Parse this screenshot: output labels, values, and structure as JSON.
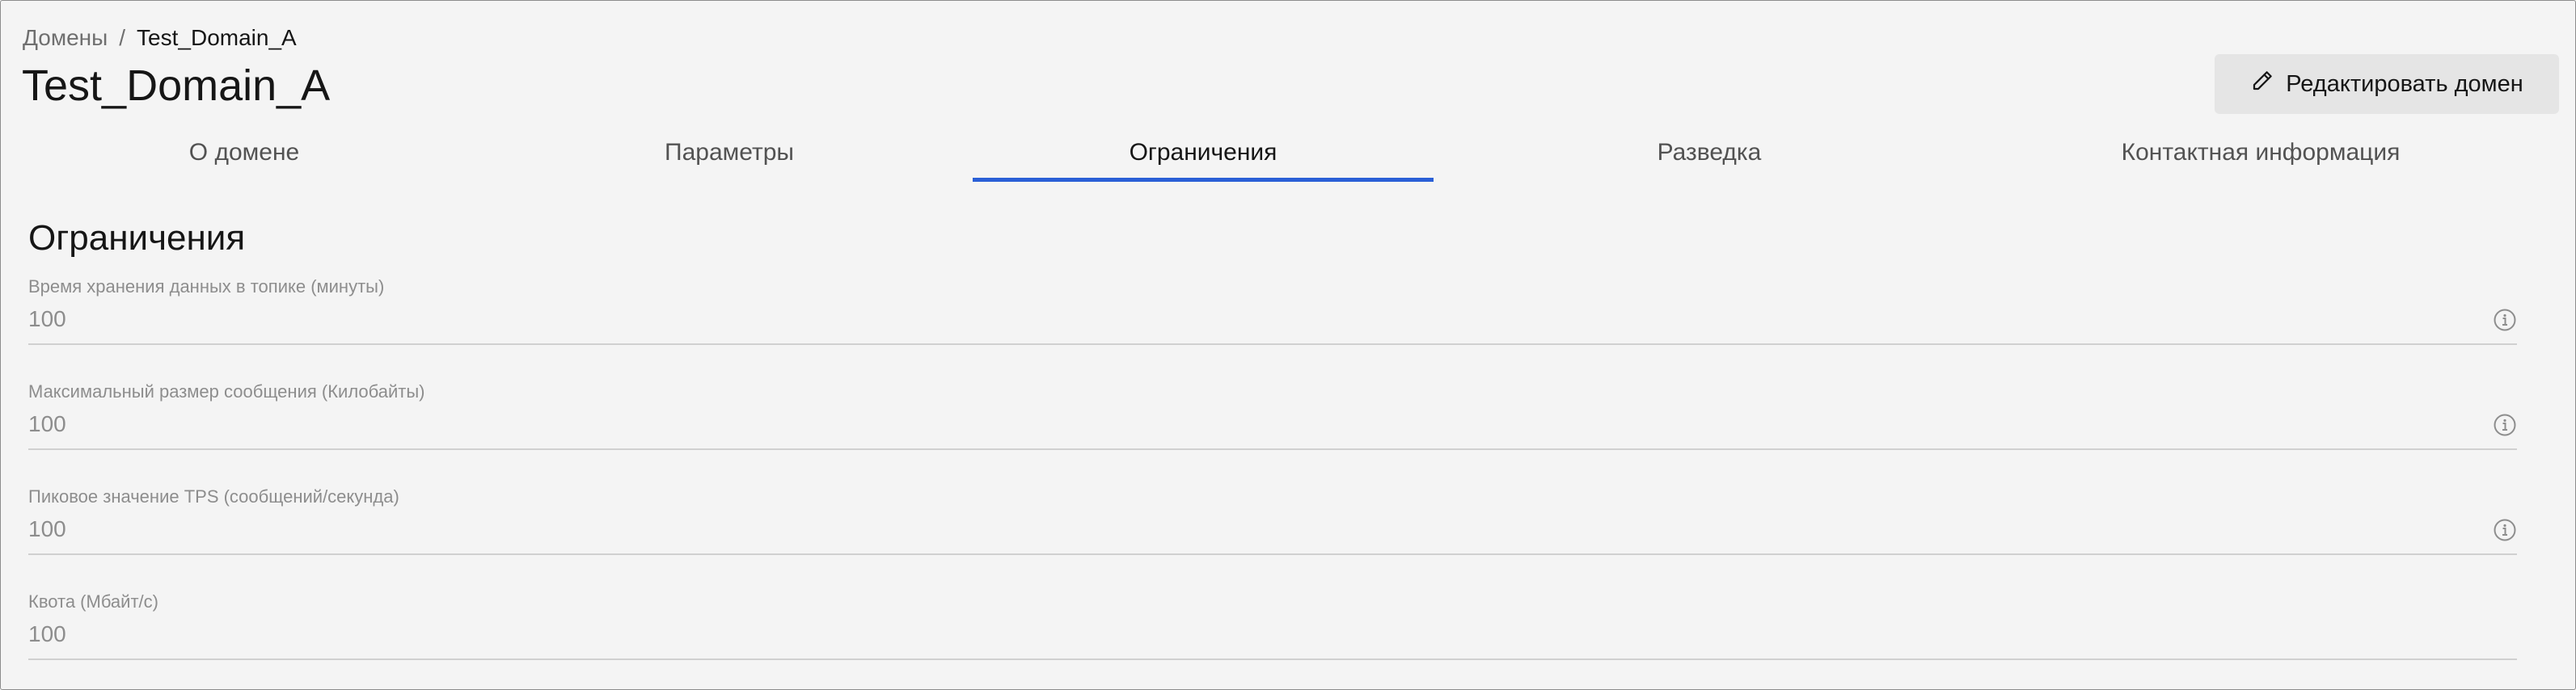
{
  "breadcrumb": {
    "parent": "Домены",
    "separator": "/",
    "current": "Test_Domain_A"
  },
  "page": {
    "title": "Test_Domain_A",
    "edit_button_label": "Редактировать домен",
    "edit_button_icon": "pencil-icon"
  },
  "tabs": [
    {
      "label": "О домене",
      "active": false
    },
    {
      "label": "Параметры",
      "active": false
    },
    {
      "label": "Ограничения",
      "active": true
    },
    {
      "label": "Разведка",
      "active": false
    },
    {
      "label": "Контактная информация",
      "active": false
    }
  ],
  "section": {
    "title": "Ограничения"
  },
  "fields": [
    {
      "label": "Время хранения данных в топике (минуты)",
      "value": "100",
      "has_info_icon": true
    },
    {
      "label": "Максимальный размер сообщения (Килобайты)",
      "value": "100",
      "has_info_icon": true
    },
    {
      "label": "Пиковое значение TPS (сообщений/секунда)",
      "value": "100",
      "has_info_icon": true
    },
    {
      "label": "Квота (Мбайт/с)",
      "value": "100",
      "has_info_icon": false
    }
  ],
  "colors": {
    "background": "#f4f4f4",
    "active_tab_underline": "#2a5fd6",
    "button_background": "#e5e5e5",
    "text_primary": "#161616",
    "text_secondary": "#8d8d8d"
  }
}
